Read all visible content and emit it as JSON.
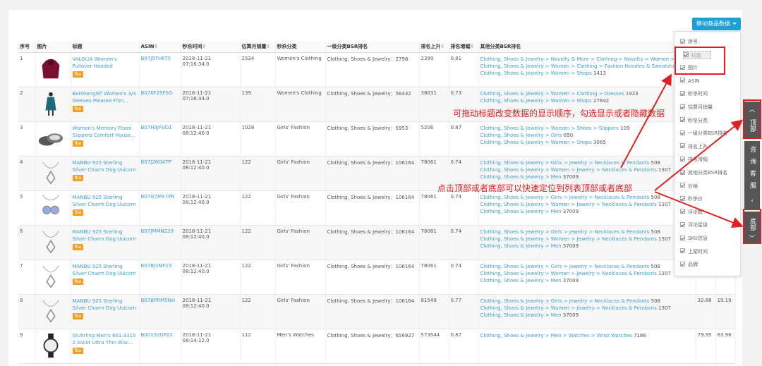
{
  "toolbar": {
    "move_data_label": "移动商品数据"
  },
  "table": {
    "headers": {
      "index": "序号",
      "image": "图片",
      "title": "标题",
      "asin": "ASIN",
      "flash_time": "秒杀时间",
      "monthly_sales": "估算月销量",
      "flash_category": "秒杀分类",
      "bsr_primary": "一级分类BSR排名",
      "rank_up": "排名上升",
      "rank_growth": "排名增幅",
      "bsr_other": "其他分类BSR排名"
    },
    "rows": [
      {
        "index": "1",
        "image_icon": "hoodie-image",
        "title": "VALOLIA Women's Pullover Hooded Sweatshirt L...",
        "badge": "fba",
        "asin": "B07J5THKT5",
        "time": "2018-11-21 07:16:34.0",
        "sales": "2534",
        "category": "Women's Clothing",
        "bsr": "Clothing, Shoes & Jewelry：2798",
        "rank_up": "2399",
        "growth": "0.81",
        "bsr_other": [
          {
            "path": "Clothing, Shoes & Jewelry > Novelty & More > Clothing > Novelty > Women > Ho",
            "num": ""
          },
          {
            "path": "Clothing, Shoes & Jewelry > Women > Clothing > Fashion Hoodies & Sweatshirt",
            "num": ""
          },
          {
            "path": "Clothing, Shoes & Jewelry > Women > Shops",
            "num": "1413"
          }
        ],
        "price": "",
        "flash_price": ""
      },
      {
        "index": "2",
        "image_icon": "dress-image",
        "title": "BaiShengGT Women's 3/4 Sleeves Pleated Fron...",
        "badge": "fba",
        "asin": "B076F25FSG",
        "time": "2018-11-21 07:16:34.0",
        "sales": "139",
        "category": "Women's Clothing",
        "bsr": "Clothing, Shoes & Jewelry：56432",
        "rank_up": "38031",
        "growth": "0.73",
        "bsr_other": [
          {
            "path": "Clothing, Shoes & Jewelry > Women > Clothing > Dresses",
            "num": "1923"
          },
          {
            "path": "Clothing, Shoes & Jewelry > Women > Shops",
            "num": "27642"
          }
        ],
        "price": "",
        "flash_price": ""
      },
      {
        "index": "3",
        "image_icon": "slippers-image",
        "title": "Women's Memory Foam Slippers Comfort House...",
        "badge": "fba",
        "asin": "B07H3JFVD1",
        "time": "2018-11-21 08:12:40.0",
        "sales": "1028",
        "category": "Girls' Fashion",
        "bsr": "Clothing, Shoes & Jewelry：5953",
        "rank_up": "5206",
        "growth": "0.87",
        "bsr_other": [
          {
            "path": "Clothing, Shoes & Jewelry > Women > Shoes > Slippers",
            "num": "109"
          },
          {
            "path": "Clothing, Shoes & Jewelry > Girls",
            "num": "650"
          },
          {
            "path": "Clothing, Shoes & Jewelry > Women > Shops",
            "num": "3065"
          }
        ],
        "price": "",
        "flash_price": ""
      },
      {
        "index": "4",
        "image_icon": "necklace-image",
        "title": "MANBU 925 Sterling Silver Charm Dog Uuicorn ...",
        "badge": "fba",
        "asin": "B07J26G4TP",
        "time": "2018-11-21 08:12:40.0",
        "sales": "122",
        "category": "Girls' Fashion",
        "bsr": "Clothing, Shoes & Jewelry：106164",
        "rank_up": "78061",
        "growth": "0.74",
        "bsr_other": [
          {
            "path": "Clothing, Shoes & Jewelry > Girls > Jewelry > Necklaces & Pendants",
            "num": "508"
          },
          {
            "path": "Clothing, Shoes & Jewelry > Women > Jewelry > Necklaces & Pendants",
            "num": "1307"
          },
          {
            "path": "Clothing, Shoes & Jewelry > Men",
            "num": "37009"
          }
        ],
        "price": "",
        "flash_price": ""
      },
      {
        "index": "5",
        "image_icon": "owl-necklace-image",
        "title": "MANBU 925 Sterling Silver Charm Dog Uuicorn ...",
        "badge": "fba",
        "asin": "B07G7MX7FN",
        "time": "2018-11-21 08:12:40.0",
        "sales": "122",
        "category": "Girls' Fashion",
        "bsr": "Clothing, Shoes & Jewelry：106164",
        "rank_up": "78061",
        "growth": "0.74",
        "bsr_other": [
          {
            "path": "Clothing, Shoes & Jewelry > Girls > Jewelry > Necklaces & Pendants",
            "num": "508"
          },
          {
            "path": "Clothing, Shoes & Jewelry > Women > Jewelry > Necklaces & Pendants",
            "num": "1307"
          },
          {
            "path": "Clothing, Shoes & Jewelry > Men",
            "num": "37009"
          }
        ],
        "price": "",
        "flash_price": ""
      },
      {
        "index": "6",
        "image_icon": "necklace-image",
        "title": "MANBU 925 Sterling Silver Charm Dog Uuicorn ...",
        "badge": "fba",
        "asin": "B07JMMN229",
        "time": "2018-11-21 08:12:40.0",
        "sales": "122",
        "category": "Girls' Fashion",
        "bsr": "Clothing, Shoes & Jewelry：106164",
        "rank_up": "78061",
        "growth": "0.74",
        "bsr_other": [
          {
            "path": "Clothing, Shoes & Jewelry > Girls > Jewelry > Necklaces & Pendants",
            "num": "508"
          },
          {
            "path": "Clothing, Shoes & Jewelry > Women > Jewelry > Necklaces & Pendants",
            "num": "1307"
          },
          {
            "path": "Clothing, Shoes & Jewelry > Men",
            "num": "37009"
          }
        ],
        "price": "",
        "flash_price": ""
      },
      {
        "index": "7",
        "image_icon": "necklace-image",
        "title": "MANBU 925 Sterling Silver Charm Dog Uuicorn ...",
        "badge": "fba",
        "asin": "B07BJ1MF23",
        "time": "2018-11-21 08:12:40.0",
        "sales": "122",
        "category": "Girls' Fashion",
        "bsr": "Clothing, Shoes & Jewelry：106164",
        "rank_up": "78061",
        "growth": "0.74",
        "bsr_other": [
          {
            "path": "Clothing, Shoes & Jewelry > Girls > Jewelry > Necklaces & Pendants",
            "num": "508"
          },
          {
            "path": "Clothing, Shoes & Jewelry > Women > Jewelry > Necklaces & Pendants",
            "num": "1307"
          },
          {
            "path": "Clothing, Shoes & Jewelry > Men",
            "num": "37009"
          }
        ],
        "price": "",
        "flash_price": ""
      },
      {
        "index": "8",
        "image_icon": "necklace-image",
        "title": "MANBU 925 Sterling Silver Charm Dog Uuicorn ...",
        "badge": "fba",
        "asin": "B07BPRM5NH",
        "time": "2018-11-21 08:12:40.0",
        "sales": "122",
        "category": "Girls' Fashion",
        "bsr": "Clothing, Shoes & Jewelry：106164",
        "rank_up": "81549",
        "growth": "0.77",
        "bsr_other": [
          {
            "path": "Clothing, Shoes & Jewelry > Girls > Jewelry > Necklaces & Pendants",
            "num": "508"
          },
          {
            "path": "Clothing, Shoes & Jewelry > Women > Jewelry > Necklaces & Pendants",
            "num": "1307"
          },
          {
            "path": "Clothing, Shoes & Jewelry > Men",
            "num": "37009"
          }
        ],
        "price": "32.88",
        "flash_price": "19.19"
      },
      {
        "index": "9",
        "image_icon": "watch-image",
        "title": "Stuhrling Men's 601.3315 2 Ascot Ultra Thin Blac...",
        "badge": "fba",
        "asin": "B00132UP22",
        "time": "2018-11-21 08:14:12.0",
        "sales": "112",
        "category": "Men's Watches",
        "bsr": "Clothing, Shoes & Jewelry：656927",
        "rank_up": "573544",
        "growth": "0.87",
        "bsr_other": [
          {
            "path": "Clothing, Shoes & Jewelry > Men > Watches > Wrist Watches",
            "num": "7186"
          }
        ],
        "price": "79.95",
        "flash_price": "63.96"
      }
    ]
  },
  "column_menu": {
    "items": [
      {
        "label": "序号",
        "state": "checked"
      },
      {
        "label": "标题",
        "state": "dragging"
      },
      {
        "label": "图片",
        "state": "checked"
      },
      {
        "label": "ASIN",
        "state": "checked"
      },
      {
        "label": "秒杀时间",
        "state": "checked"
      },
      {
        "label": "估算月销量",
        "state": "checked"
      },
      {
        "label": "秒杀分类",
        "state": "checked"
      },
      {
        "label": "一级分类BSR排名",
        "state": "checked"
      },
      {
        "label": "排名上升",
        "state": "checked"
      },
      {
        "label": "排名增幅",
        "state": "checked"
      },
      {
        "label": "其他分类BSR排名",
        "state": "checked"
      },
      {
        "label": "价格",
        "state": "checked"
      },
      {
        "label": "秒杀价",
        "state": "checked"
      },
      {
        "label": "评论数",
        "state": "checked"
      },
      {
        "label": "评论星级",
        "state": "checked"
      },
      {
        "label": "SKU信息",
        "state": "checked"
      },
      {
        "label": "上架时间",
        "state": "checked"
      },
      {
        "label": "品牌",
        "state": "checked"
      }
    ]
  },
  "side": {
    "top_label": "顶部",
    "consult_label": "咨询客服",
    "bottom_label": "底部"
  },
  "annotations": {
    "drag_tip": "可拖动标题改变数据的显示顺序，勾选显示或者隐藏数据",
    "nav_tip": "点击顶部或者底部可以快速定位到列表顶部或者底部"
  },
  "colors": {
    "accent": "#1ea0d5",
    "link": "#3aa0d5",
    "badge": "#f0a028",
    "annotation": "#e02020"
  }
}
